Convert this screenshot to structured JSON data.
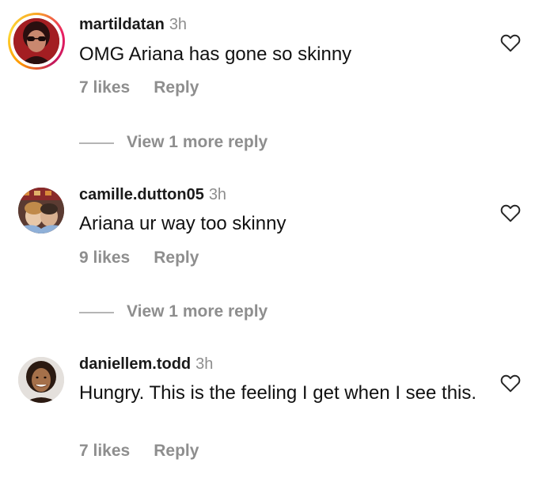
{
  "comments": [
    {
      "username": "martildatan",
      "time": "3h",
      "text": "OMG Ariana has gone so skinny",
      "likes": "7 likes",
      "reply": "Reply",
      "avatar_icon": "profile-photo-woman-red-sunglasses",
      "view_more": "View 1 more reply"
    },
    {
      "username": "camille.dutton05",
      "time": "3h",
      "text": "Ariana ur way too skinny",
      "likes": "9 likes",
      "reply": "Reply",
      "avatar_icon": "profile-photo-two-people",
      "view_more": "View 1 more reply"
    },
    {
      "username": "daniellem.todd",
      "time": "3h",
      "text": "Hungry. This is the feeling I get when I see this.",
      "likes": "7 likes",
      "reply": "Reply",
      "avatar_icon": "profile-photo-smiling-woman"
    }
  ],
  "colors": {
    "secondary_text": "#8e8e8e",
    "story_ring_start": "#f9a825",
    "story_ring_end": "#e91e63"
  },
  "icons": {
    "like": "heart-outline-icon"
  }
}
